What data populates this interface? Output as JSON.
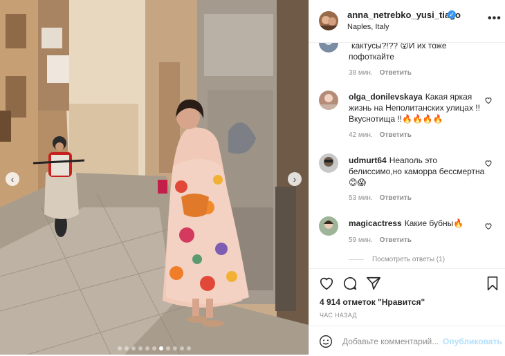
{
  "photo": {
    "slides_count": 11,
    "active_slide": 6,
    "prev_icon": "chevron-left-icon",
    "next_icon": "chevron-right-icon"
  },
  "header": {
    "author": "anna_netrebko_yusi_tiago",
    "location": "Naples, Italy",
    "verified_color": "#3897f0",
    "more_label": "•••"
  },
  "comments": [
    {
      "user": "",
      "text": "кактусы?!?? 😮И их тоже пофоткайте",
      "time": "38 мин.",
      "reply": "Ответить"
    },
    {
      "user": "olga_donilevskaya",
      "text": "Какая яркая жизнь на Неполитанских улицах !! Вкуснотища !!🔥🔥🔥🔥",
      "time": "42 мин.",
      "reply": "Ответить"
    },
    {
      "user": "udmurt64",
      "text": "Неаполь это белиссимо,но каморра бессмертна😊😱",
      "time": "53 мин.",
      "reply": "Ответить"
    },
    {
      "user": "magicactress",
      "text": "Какие бубны🔥",
      "time": "59 мин.",
      "reply": "Ответить"
    }
  ],
  "view_replies": "Посмотреть ответы (1)",
  "actions": {
    "likes": "4 914 отметок \"Нравится\"",
    "time": "ЧАС НАЗАД"
  },
  "add_comment": {
    "placeholder": "Добавьте комментарий...",
    "publish": "Опубликовать",
    "publish_color": "#b2dffc"
  }
}
